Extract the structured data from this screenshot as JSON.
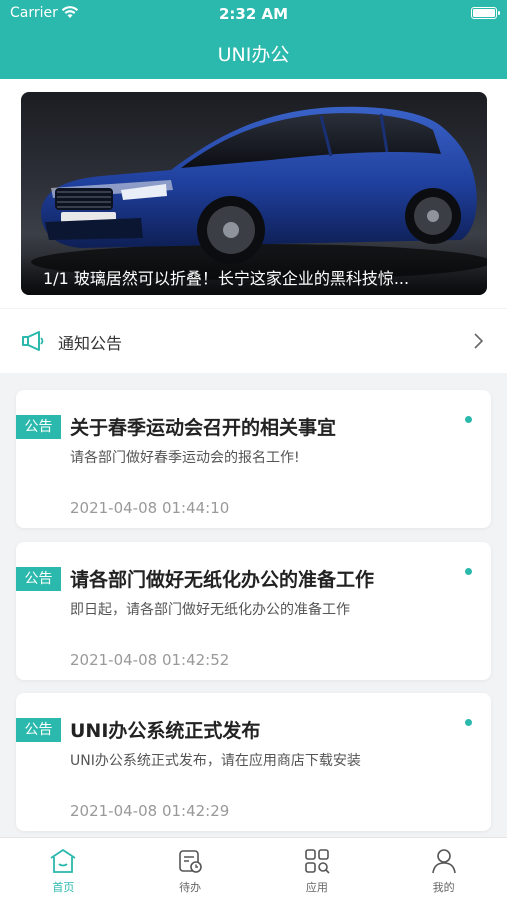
{
  "status_bar": {
    "carrier": "Carrier",
    "time": "2:32 AM"
  },
  "nav": {
    "title": "UNI办公"
  },
  "banner": {
    "caption": "1/1  玻璃居然可以折叠！长宁这家企业的黑科技惊..."
  },
  "notice_bar": {
    "label": "通知公告",
    "icon": "megaphone-icon"
  },
  "colors": {
    "accent": "#2bb8ad"
  },
  "announcements": [
    {
      "tag": "公告",
      "title": "关于春季运动会召开的相关事宜",
      "desc": "请各部门做好春季运动会的报名工作!",
      "time": "2021-04-08 01:44:10"
    },
    {
      "tag": "公告",
      "title": "请各部门做好无纸化办公的准备工作",
      "desc": "即日起，请各部门做好无纸化办公的准备工作",
      "time": "2021-04-08 01:42:52"
    },
    {
      "tag": "公告",
      "title": "UNI办公系统正式发布",
      "desc": "UNI办公系统正式发布，请在应用商店下载安装",
      "time": "2021-04-08 01:42:29"
    }
  ],
  "tabbar": [
    {
      "label": "首页",
      "icon": "home-icon",
      "active": true
    },
    {
      "label": "待办",
      "icon": "todo-icon",
      "active": false
    },
    {
      "label": "应用",
      "icon": "apps-icon",
      "active": false
    },
    {
      "label": "我的",
      "icon": "user-icon",
      "active": false
    }
  ]
}
